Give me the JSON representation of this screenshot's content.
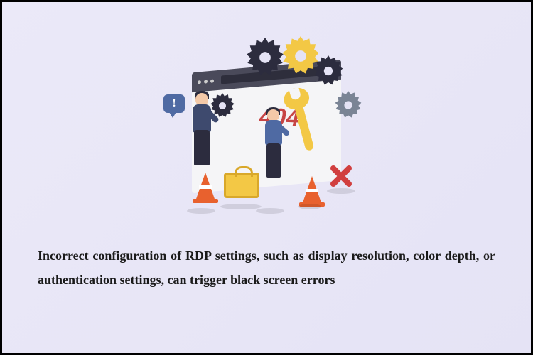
{
  "illustration": {
    "error_code": "404",
    "speech_bubble_text": "!",
    "gear_colors": {
      "gear1": "#2c2c3e",
      "gear2": "#f3c845",
      "gear3": "#2c2c3e",
      "gear4": "#7a8495"
    },
    "cone_color": "#e8612e",
    "toolbox_color": "#f3c845",
    "wrench_color": "#f3c845",
    "x_icon_color": "#d13f3f"
  },
  "caption": "Incorrect configuration of RDP settings, such as display resolution, color depth, or authentication settings, can trigger black screen errors"
}
